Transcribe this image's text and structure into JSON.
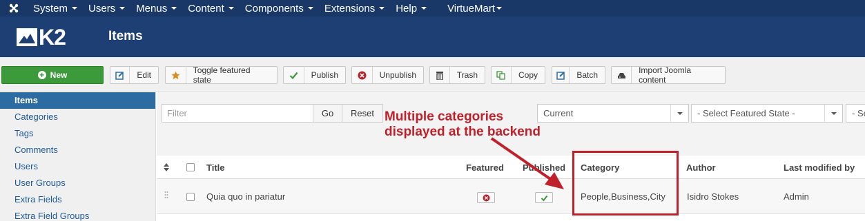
{
  "topmenu": {
    "items": [
      {
        "label": "System",
        "caret": true
      },
      {
        "label": "Users",
        "caret": true
      },
      {
        "label": "Menus",
        "caret": true
      },
      {
        "label": "Content",
        "caret": true
      },
      {
        "label": "Components",
        "caret": true
      },
      {
        "label": "Extensions",
        "caret": true
      },
      {
        "label": "Help",
        "caret": true
      },
      {
        "label": "VirtueMart",
        "caret": true
      }
    ]
  },
  "header": {
    "logo_text": "K2",
    "title": "Items"
  },
  "toolbar": {
    "new_label": "New",
    "edit_label": "Edit",
    "toggle_featured_label": "Toggle featured state",
    "publish_label": "Publish",
    "unpublish_label": "Unpublish",
    "trash_label": "Trash",
    "copy_label": "Copy",
    "batch_label": "Batch",
    "import_label": "Import Joomla content"
  },
  "sidebar": {
    "items": [
      {
        "label": "Items",
        "active": true
      },
      {
        "label": "Categories"
      },
      {
        "label": "Tags"
      },
      {
        "label": "Comments"
      },
      {
        "label": "Users"
      },
      {
        "label": "User Groups"
      },
      {
        "label": "Extra Fields"
      },
      {
        "label": "Extra Field Groups"
      }
    ]
  },
  "filters": {
    "search_placeholder": "Filter",
    "go_label": "Go",
    "reset_label": "Reset",
    "state_select": "Current",
    "featured_select": "- Select Featured State -",
    "third_select": "- Se"
  },
  "table": {
    "headers": {
      "title": "Title",
      "featured": "Featured",
      "published": "Published",
      "category": "Category",
      "author": "Author",
      "modified": "Last modified by"
    },
    "rows": [
      {
        "title": "Quia quo in pariatur",
        "featured": false,
        "published": true,
        "category": "People,Business,City",
        "author": "Isidro Stokes",
        "modified_by": "Admin"
      }
    ]
  },
  "annotation": {
    "line1": "Multiple categories",
    "line2": "displayed at the backend",
    "color": "#c0202a"
  },
  "colors": {
    "topbar": "#1a3867",
    "header": "#1d3f73",
    "new_button": "#3c9a3a",
    "sidebar_active": "#2d6ca2"
  }
}
